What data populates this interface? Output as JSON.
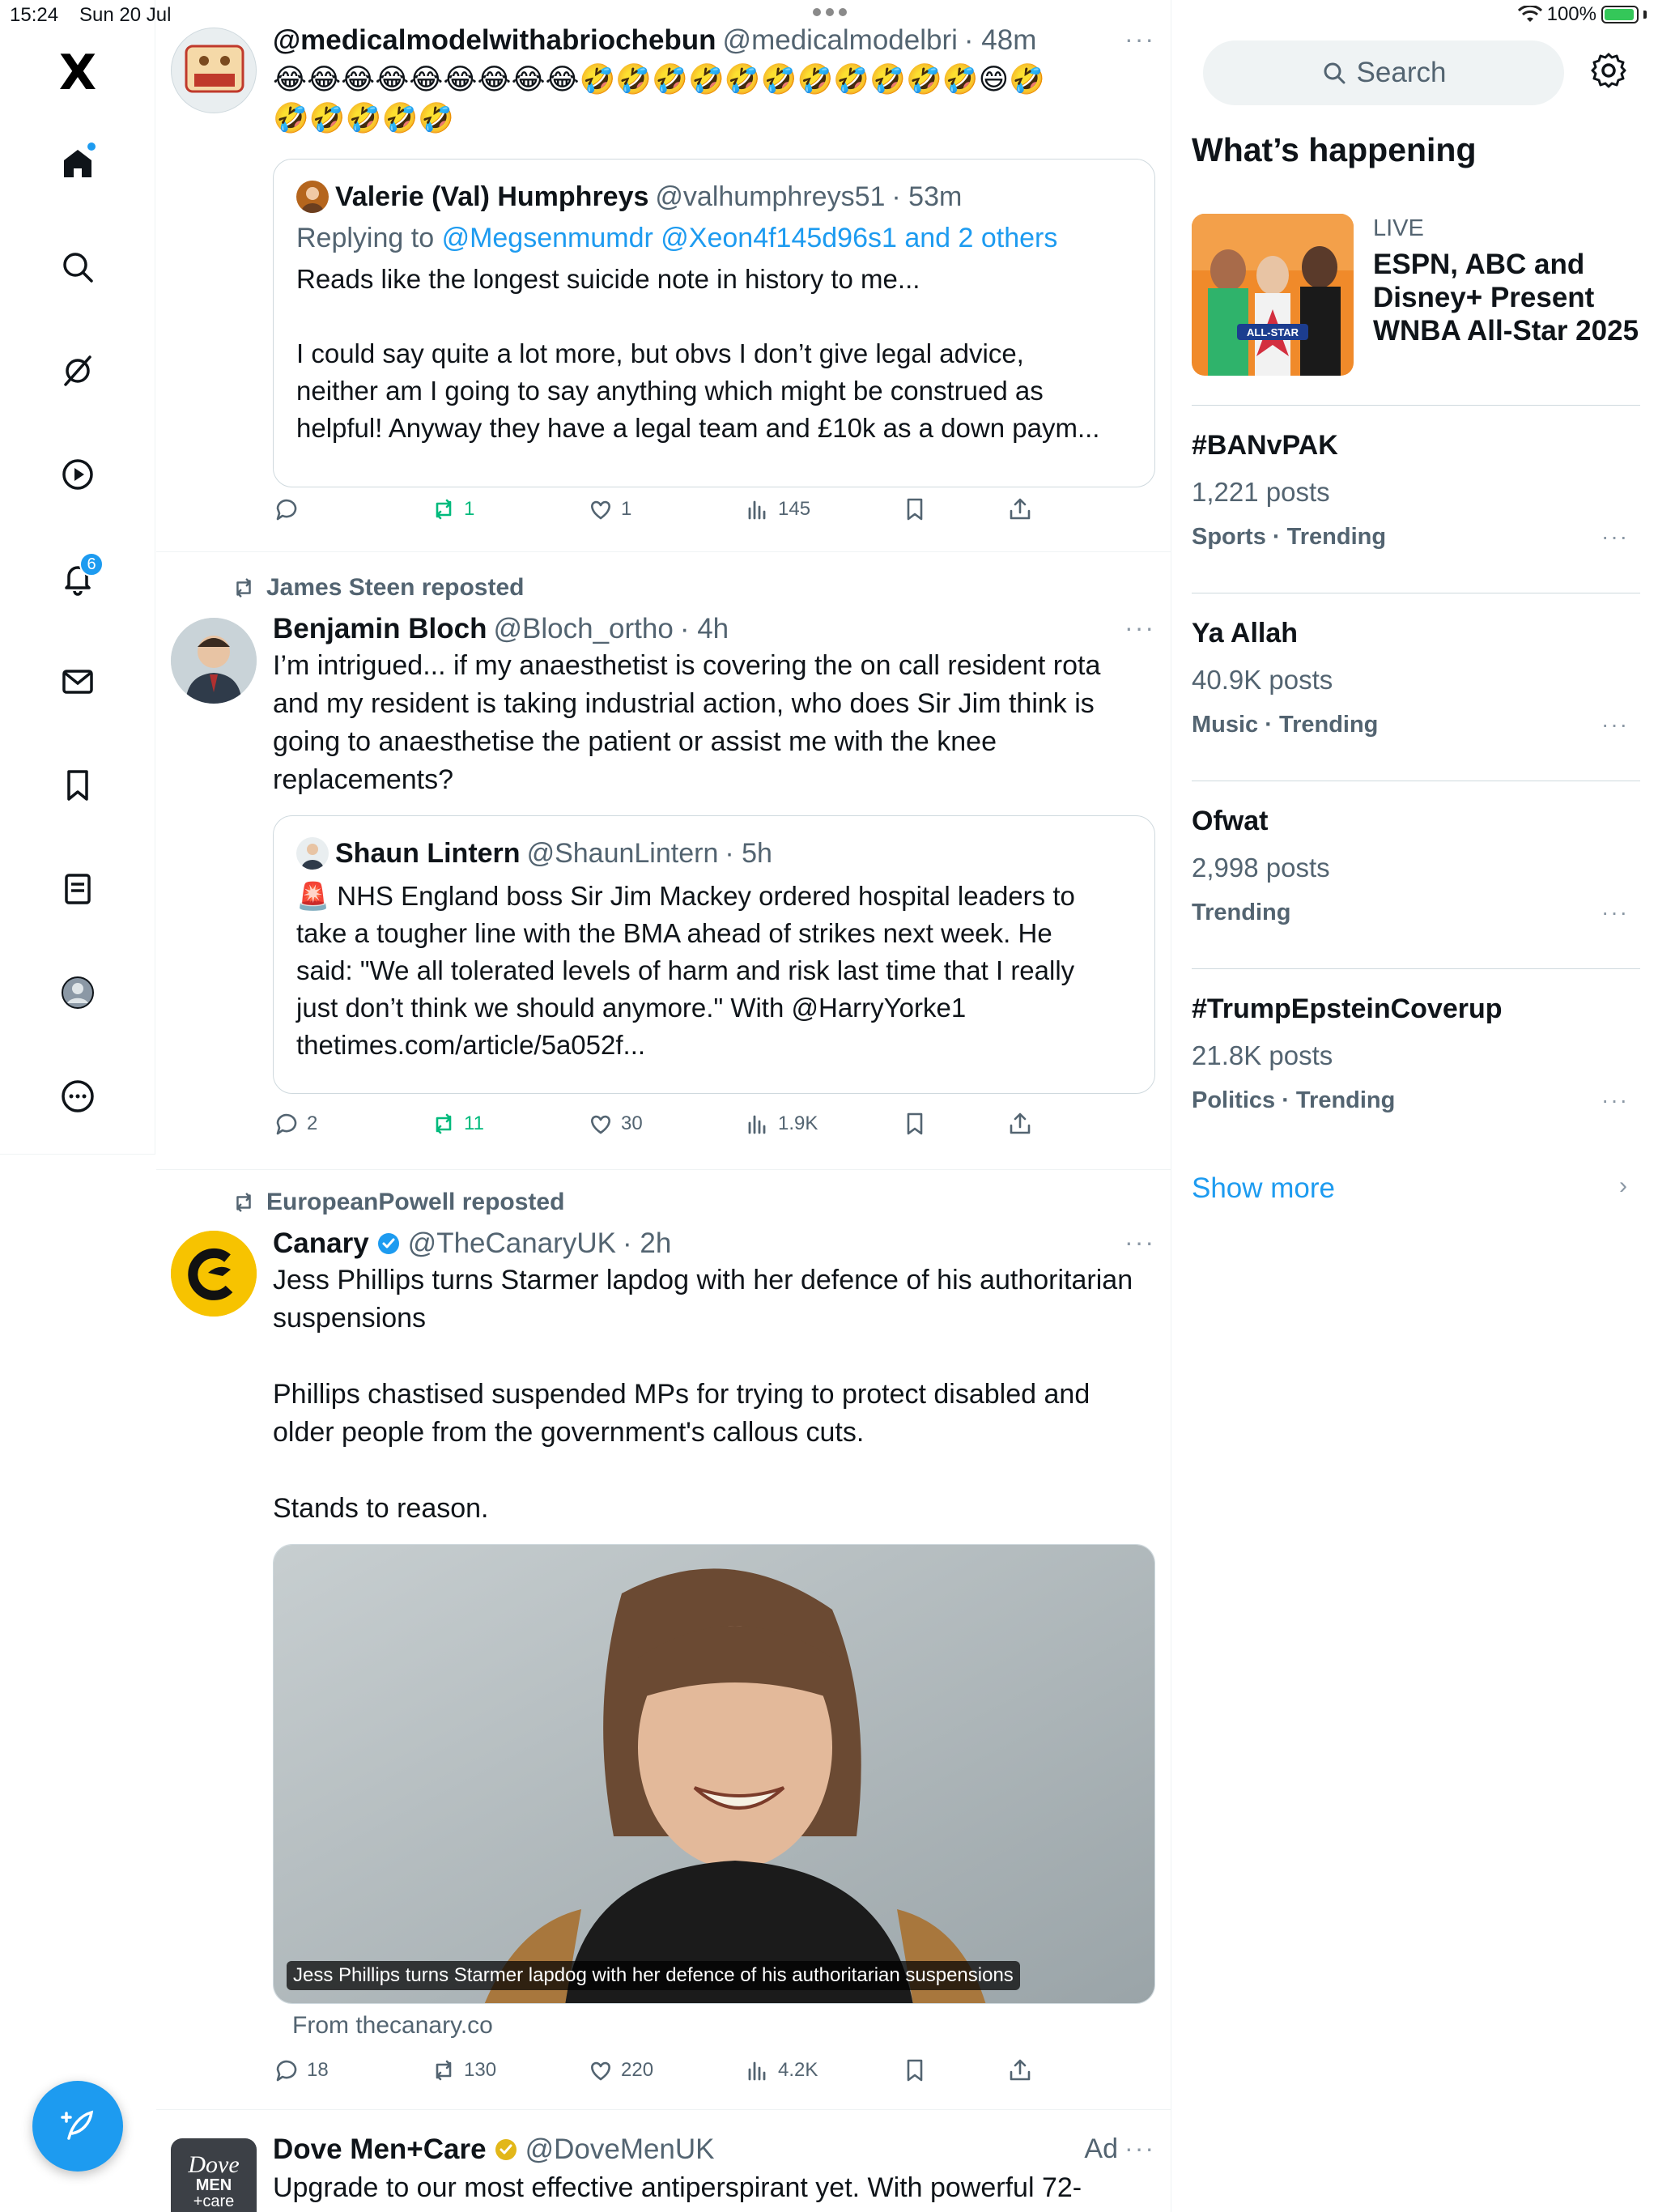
{
  "status_bar": {
    "time": "15:24",
    "date": "Sun 20 Jul",
    "battery": "100%"
  },
  "nav": {
    "logo": "X",
    "items": [
      "home-icon",
      "search-icon",
      "grok-icon",
      "video-icon",
      "bell-icon",
      "mail-icon",
      "bookmark-icon",
      "lists-icon",
      "profile-icon",
      "more-icon"
    ],
    "notification_count": "6"
  },
  "timeline": {
    "tweets": [
      {
        "name": "@medicalmodelwithabriochebun",
        "handle": "@medicalmodelbri",
        "time": "· 48m",
        "text": "😂😂😂😂😂😂😂😂😂🤣🤣🤣🤣🤣🤣🤣🤣🤣🤣🤣😄🤣\n🤣🤣🤣🤣🤣",
        "quote": {
          "name": "Valerie (Val) Humphreys",
          "handle": "@valhumphreys51",
          "time": "· 53m",
          "replying_label": "Replying to",
          "replying_to": "@Megsenmumdr @Xeon4f145d96s1 and 2 others",
          "text": "Reads like the longest suicide note in history to me...\n\nI could say quite a lot more, but obvs I don’t give legal advice,\nneither am I going to say anything which might be construed as\nhelpful! Anyway they have a legal team and £10k as a down paym..."
        },
        "replies": "",
        "reposts": "1",
        "likes": "1",
        "views": "145"
      },
      {
        "social_context": "James Steen reposted",
        "name": "Benjamin Bloch",
        "handle": "@Bloch_ortho",
        "time": "· 4h",
        "text": "I’m intrigued... if my anaesthetist is covering the on call resident rota\nand my resident is taking industrial action, who does Sir Jim think is\ngoing to anaesthetise the patient or assist me with the knee\nreplacements?",
        "quote": {
          "name": "Shaun Lintern",
          "handle": "@ShaunLintern",
          "time": "· 5h",
          "text": "🚨 NHS England boss Sir Jim Mackey ordered hospital leaders to\ntake a tougher line with the BMA ahead of strikes next week. He\nsaid: \"We all tolerated levels of harm and risk last time that I really\njust don’t think we should anymore.\" With @HarryYorke1\nthetimes.com/article/5a052f..."
        },
        "replies": "2",
        "reposts": "11",
        "likes": "30",
        "views": "1.9K"
      },
      {
        "social_context": "EuropeanPowell reposted",
        "name": "Canary",
        "handle": "@TheCanaryUK",
        "time": "· 2h",
        "text": "Jess Phillips turns Starmer lapdog with her defence of his authoritarian\nsuspensions\n\nPhillips chastised suspended MPs for trying to protect disabled and\nolder people from the government's callous cuts.\n\nStands to reason.",
        "media_caption": "Jess Phillips turns Starmer lapdog with her defence of his authoritarian suspensions",
        "link_source": "From thecanary.co",
        "replies": "18",
        "reposts": "130",
        "likes": "220",
        "views": "4.2K"
      },
      {
        "name": "Dove Men+Care",
        "handle": "@DoveMenUK",
        "ad_label": "Ad",
        "text": "Upgrade to our most effective antiperspirant yet. With powerful 72-",
        "avatar_text_1": "Dove",
        "avatar_text_2": "MEN",
        "avatar_text_3": "+care"
      }
    ]
  },
  "right": {
    "search_placeholder": "Search",
    "section_title": "What’s happening",
    "live": {
      "label": "LIVE",
      "title": "ESPN, ABC and Disney+ Present WNBA All-Star 2025",
      "thumb_text": "ALL-STAR"
    },
    "trends": [
      {
        "name": "#BANvPAK",
        "count": "1,221 posts",
        "context": "Sports · Trending"
      },
      {
        "name": "Ya Allah",
        "count": "40.9K posts",
        "context": "Music · Trending"
      },
      {
        "name": "Ofwat",
        "count": "2,998 posts",
        "context": "Trending"
      },
      {
        "name": "#TrumpEpsteinCoverup",
        "count": "21.8K posts",
        "context": "Politics · Trending"
      }
    ],
    "show_more": "Show more"
  },
  "colors": {
    "accent": "#1d9bf0",
    "repost_green": "#00ba7c",
    "secondary_text": "#536471"
  }
}
